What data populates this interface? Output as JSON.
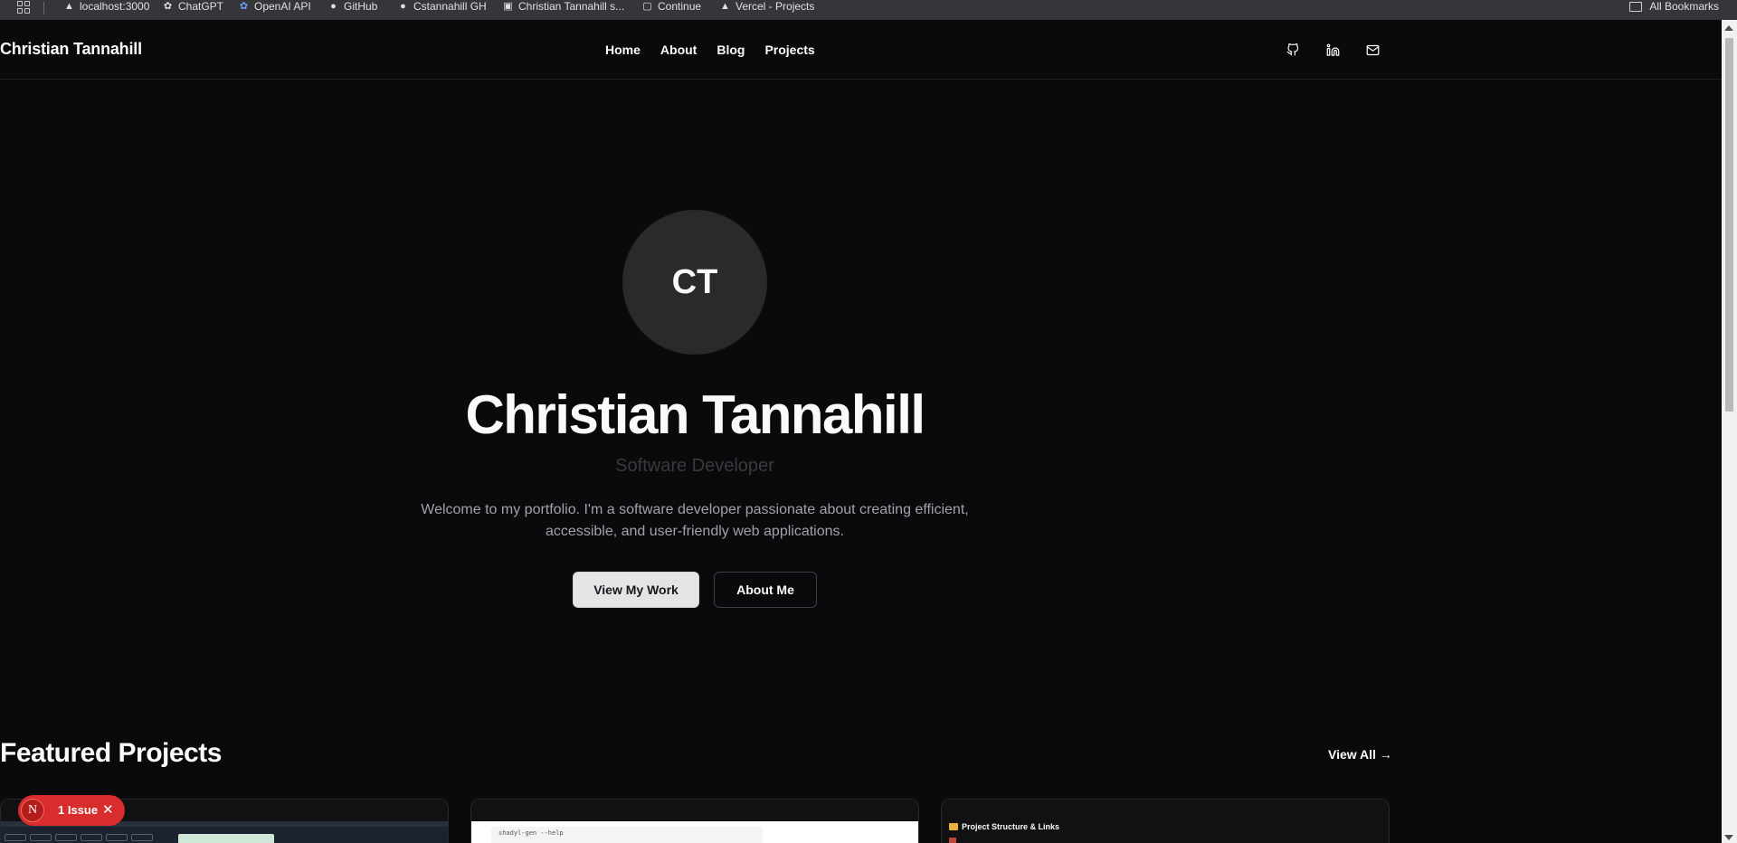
{
  "bookmarks": {
    "items": [
      {
        "label": "localhost:3000",
        "icon": "triangle-icon"
      },
      {
        "label": "ChatGPT",
        "icon": "openai-icon"
      },
      {
        "label": "OpenAI API",
        "icon": "openai-icon"
      },
      {
        "label": "GitHub",
        "icon": "github-icon"
      },
      {
        "label": "Cstannahill GH",
        "icon": "github-icon"
      },
      {
        "label": "Christian Tannahill s...",
        "icon": "page-icon"
      },
      {
        "label": "Continue",
        "icon": "continue-icon"
      },
      {
        "label": "Vercel - Projects",
        "icon": "triangle-icon"
      }
    ],
    "all_label": "All Bookmarks"
  },
  "header": {
    "brand": "Christian Tannahill",
    "nav": [
      "Home",
      "About",
      "Blog",
      "Projects"
    ],
    "social_icons": [
      "github-icon",
      "linkedin-icon",
      "mail-icon"
    ]
  },
  "hero": {
    "initials": "CT",
    "name": "Christian Tannahill",
    "role": "Software Developer",
    "intro": "Welcome to my portfolio. I'm a software developer passionate about creating efficient, accessible, and user-friendly web applications.",
    "primary_button": "View My Work",
    "secondary_button": "About Me"
  },
  "featured": {
    "title": "Featured Projects",
    "view_all": "View All →",
    "card2_code": "shadyl-gen --help",
    "card3_title": "Project Structure & Links"
  },
  "issue": {
    "badge": "N",
    "label": "1 Issue",
    "close": "✕"
  },
  "colors": {
    "background": "#0a0a0c",
    "issue_red": "#d92d2d"
  }
}
